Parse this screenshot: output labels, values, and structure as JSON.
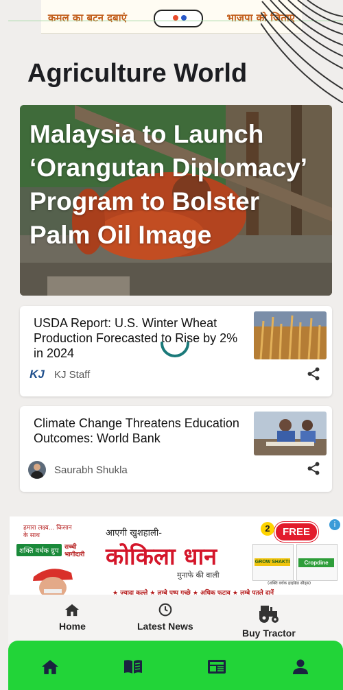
{
  "top_banner": {
    "left_text": "कमल का बटन दबाएं",
    "right_text": "भाजपा को जिताएं"
  },
  "section": {
    "title": "Agriculture World"
  },
  "hero": {
    "headline": "Malaysia to Launch ‘Orangutan Diplomacy’ Program to Bolster Palm Oil Image"
  },
  "articles": [
    {
      "title": "USDA Report: U.S. Winter Wheat Production Forecasted to Rise by 2% in 2024",
      "author": "KJ Staff",
      "author_logo": "KJ"
    },
    {
      "title": "Climate Change Threatens Education Outcomes: World Bank",
      "author": "Saurabh Shukla"
    }
  ],
  "ad": {
    "tagline_top": "हमारा लक्ष्य... किसान के साथ",
    "brand_badge": "शक्ति वर्धक ग्रुप",
    "partner_text": "सच्ची भागीदारी",
    "headline_small": "आएगी खुशहाली-",
    "product_name": "कोकिला धान",
    "product_sub": "मुनाफे की वाली",
    "offer_badge": "FREE",
    "pack_count": "2",
    "pack_left": "GROW SHAKTI",
    "pack_right": "Cropdine",
    "footnote": "(शक्ति वर्धक हाइब्रिड सीड्स)",
    "features": "★ ज्यादा कल्ले ★ लम्बे पष्प गच्छे ★ अधिक फटाव ★ लम्बे पतले दानें",
    "info_icon": "i"
  },
  "subnav": {
    "home": {
      "label": "Home",
      "icon": "home-icon"
    },
    "latest": {
      "label": "Latest News",
      "icon": "clock-icon"
    },
    "tractor": {
      "label": "Buy Tractor",
      "icon": "tractor-icon"
    }
  },
  "bottom_bar": {
    "color": "#22d438",
    "icons": [
      "home-icon",
      "book-icon",
      "newspaper-icon",
      "profile-icon"
    ]
  }
}
